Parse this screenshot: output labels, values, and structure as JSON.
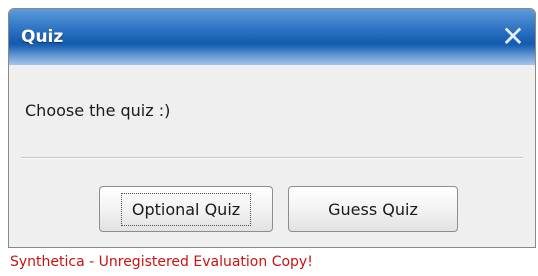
{
  "dialog": {
    "title": "Quiz",
    "close_glyph": "✕",
    "message": "Choose the quiz :)",
    "buttons": {
      "optional": "Optional Quiz",
      "guess": "Guess Quiz"
    }
  },
  "footer": {
    "text": "Synthetica - Unregistered Evaluation Copy!"
  },
  "colors": {
    "title_bar": "#2f74c4",
    "footer_text": "#cc1111"
  },
  "icons": {
    "close": "close-icon"
  }
}
